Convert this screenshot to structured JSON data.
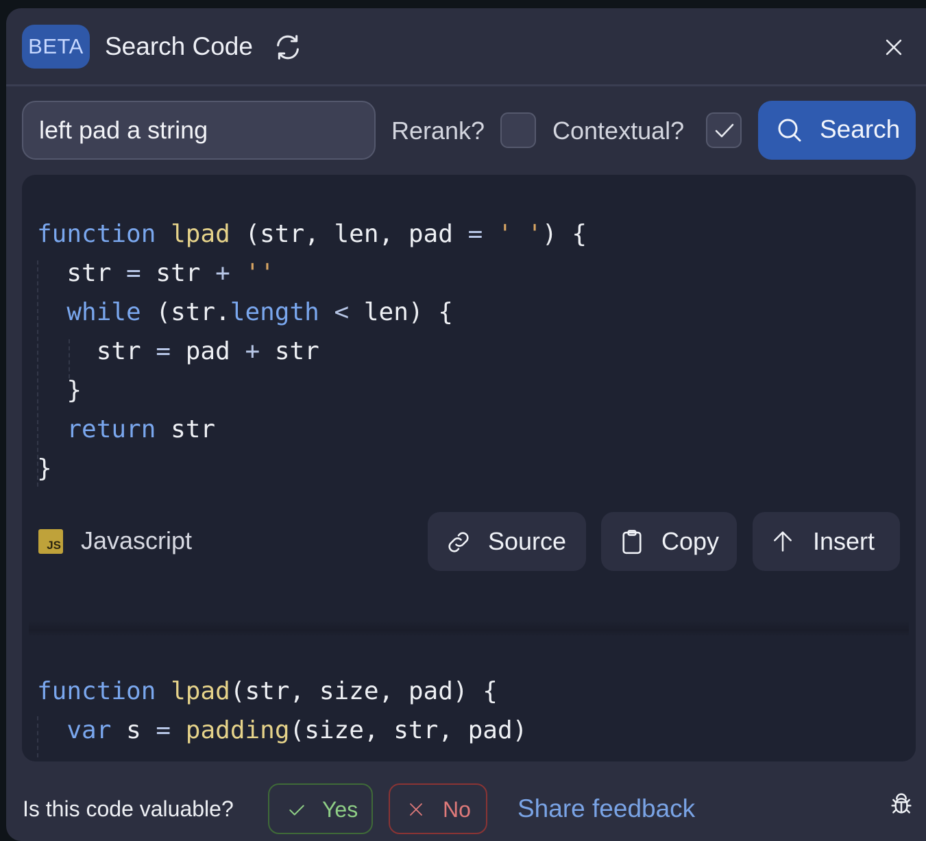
{
  "header": {
    "badge": "BETA",
    "title": "Search Code",
    "refresh_icon": "refresh-icon",
    "close_icon": "close-icon"
  },
  "search": {
    "query_value": "left pad a string",
    "rerank_label": "Rerank?",
    "rerank_checked": false,
    "contextual_label": "Contextual?",
    "contextual_checked": true,
    "button_label": "Search",
    "button_icon": "search-icon"
  },
  "results": [
    {
      "language": "Javascript",
      "language_icon": "JS",
      "code_lines": [
        [
          {
            "t": "kw",
            "v": "function"
          },
          {
            "t": "",
            "v": " "
          },
          {
            "t": "fn",
            "v": "lpad"
          },
          {
            "t": "",
            "v": " (str, len, pad "
          },
          {
            "t": "op",
            "v": "="
          },
          {
            "t": "",
            "v": " "
          },
          {
            "t": "str",
            "v": "' '"
          },
          {
            "t": "",
            "v": ") {"
          }
        ],
        [
          {
            "t": "",
            "v": "  str "
          },
          {
            "t": "op",
            "v": "="
          },
          {
            "t": "",
            "v": " str "
          },
          {
            "t": "op",
            "v": "+"
          },
          {
            "t": "",
            "v": " "
          },
          {
            "t": "str",
            "v": "''"
          }
        ],
        [
          {
            "t": "",
            "v": "  "
          },
          {
            "t": "kw",
            "v": "while"
          },
          {
            "t": "",
            "v": " (str."
          },
          {
            "t": "kw",
            "v": "length"
          },
          {
            "t": "",
            "v": " "
          },
          {
            "t": "op",
            "v": "<"
          },
          {
            "t": "",
            "v": " len) {"
          }
        ],
        [
          {
            "t": "",
            "v": "    str "
          },
          {
            "t": "op",
            "v": "="
          },
          {
            "t": "",
            "v": " pad "
          },
          {
            "t": "op",
            "v": "+"
          },
          {
            "t": "",
            "v": " str"
          }
        ],
        [
          {
            "t": "",
            "v": "  }"
          }
        ],
        [
          {
            "t": "",
            "v": "  "
          },
          {
            "t": "kw",
            "v": "return"
          },
          {
            "t": "",
            "v": " str"
          }
        ],
        [
          {
            "t": "",
            "v": "}"
          }
        ]
      ],
      "actions": [
        {
          "label": "Source",
          "icon": "link-icon"
        },
        {
          "label": "Copy",
          "icon": "clipboard-icon"
        },
        {
          "label": "Insert",
          "icon": "arrow-up-icon"
        }
      ]
    },
    {
      "code_lines": [
        [
          {
            "t": "kw",
            "v": "function"
          },
          {
            "t": "",
            "v": " "
          },
          {
            "t": "fn",
            "v": "lpad"
          },
          {
            "t": "",
            "v": "(str, size, pad) {"
          }
        ],
        [
          {
            "t": "",
            "v": "  "
          },
          {
            "t": "kw",
            "v": "var"
          },
          {
            "t": "",
            "v": " s "
          },
          {
            "t": "op",
            "v": "="
          },
          {
            "t": "",
            "v": " "
          },
          {
            "t": "fn",
            "v": "padding"
          },
          {
            "t": "",
            "v": "(size, str, pad)"
          }
        ]
      ]
    }
  ],
  "footer": {
    "question": "Is this code valuable?",
    "yes_label": "Yes",
    "no_label": "No",
    "share_label": "Share feedback",
    "bug_icon": "bug-icon"
  },
  "colors": {
    "accent": "#2f5bb0",
    "panel_bg": "#2c2f40",
    "code_bg": "#1e2231",
    "keyword": "#7aa7ee",
    "function": "#e6d38a",
    "string": "#d9a663",
    "yes": "#8fcf86",
    "no": "#e07a7a",
    "link": "#7aa4e6"
  }
}
